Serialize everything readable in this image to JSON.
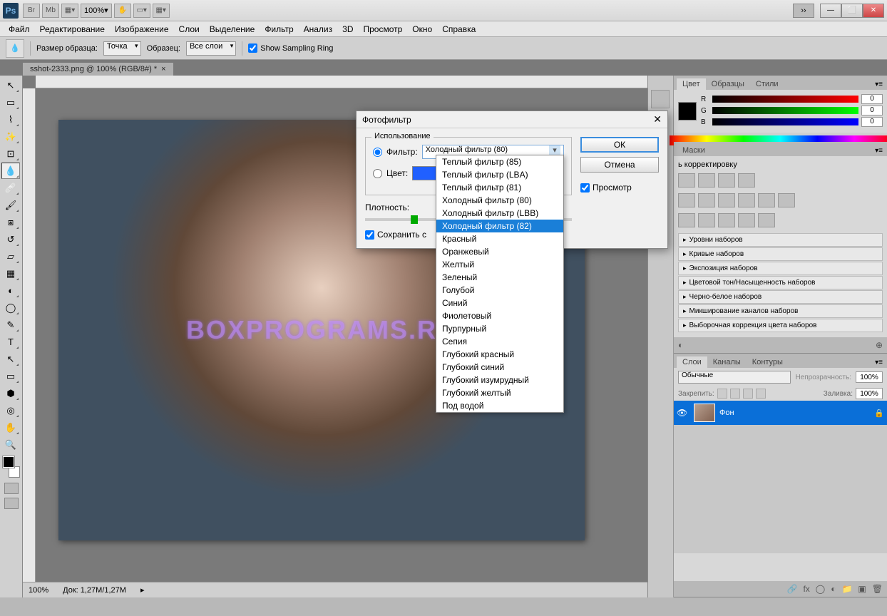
{
  "titlebar": {
    "logo": "Ps",
    "br": "Br",
    "mb": "Mb",
    "zoom": "100%"
  },
  "menu": [
    "Файл",
    "Редактирование",
    "Изображение",
    "Слои",
    "Выделение",
    "Фильтр",
    "Анализ",
    "3D",
    "Просмотр",
    "Окно",
    "Справка"
  ],
  "options": {
    "sample_label": "Размер образца:",
    "sample_value": "Точка",
    "sample2_label": "Образец:",
    "sample2_value": "Все слои",
    "show_ring": "Show Sampling Ring"
  },
  "doctab": "sshot-2333.png @ 100% (RGB/8#) *",
  "status": {
    "zoom": "100%",
    "doc": "Док: 1,27M/1,27M"
  },
  "color_panel": {
    "tabs": [
      "Цвет",
      "Образцы",
      "Стили"
    ],
    "r": "0",
    "g": "0",
    "b": "0"
  },
  "adj_panel": {
    "tab_masks": "Маски",
    "title": "ь корректировку",
    "presets": [
      "Уровни наборов",
      "Кривые наборов",
      "Экспозиция наборов",
      "Цветовой тон/Насыщенность наборов",
      "Черно-белое наборов",
      "Микширование каналов наборов",
      "Выборочная коррекция цвета наборов"
    ]
  },
  "layers_panel": {
    "tabs": [
      "Слои",
      "Каналы",
      "Контуры"
    ],
    "mode": "Обычные",
    "opacity_label": "Непрозрачность:",
    "opacity": "100%",
    "lock_label": "Закрепить:",
    "fill_label": "Заливка:",
    "fill": "100%",
    "layer_name": "Фон"
  },
  "dialog": {
    "title": "Фотофильтр",
    "use_legend": "Использование",
    "filter_label": "Фильтр:",
    "filter_value": "Холодный фильтр (80)",
    "color_label": "Цвет:",
    "density_label": "Плотность:",
    "preserve": "Сохранить с",
    "ok": "ОК",
    "cancel": "Отмена",
    "preview": "Просмотр"
  },
  "dropdown": {
    "items": [
      "Теплый фильтр (85)",
      "Теплый фильтр (LBA)",
      "Теплый фильтр (81)",
      "Холодный фильтр (80)",
      "Холодный фильтр (LBB)",
      "Холодный фильтр (82)",
      "Красный",
      "Оранжевый",
      "Желтый",
      "Зеленый",
      "Голубой",
      "Синий",
      "Фиолетовый",
      "Пурпурный",
      "Сепия",
      "Глубокий красный",
      "Глубокий синий",
      "Глубокий изумрудный",
      "Глубокий желтый",
      "Под водой"
    ],
    "highlight_index": 5
  },
  "watermark": "BOXPROGRAMS.RU"
}
